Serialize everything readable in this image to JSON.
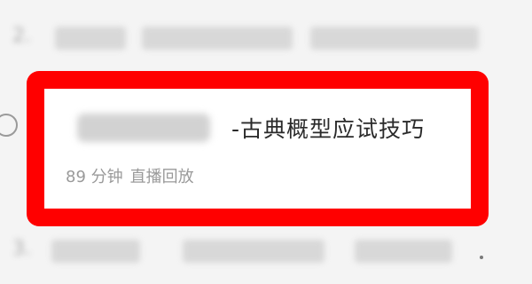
{
  "list": {
    "item_prev": {
      "number": "2."
    },
    "item_current": {
      "title_suffix": "-古典概型应试技巧",
      "duration": "89 分钟",
      "type": "直播回放"
    },
    "item_next": {
      "number": "3."
    }
  },
  "colors": {
    "highlight_border": "#ff0000",
    "title_text": "#2a2a2a",
    "meta_text": "#9a9a9a",
    "background": "#f4f4f4"
  }
}
